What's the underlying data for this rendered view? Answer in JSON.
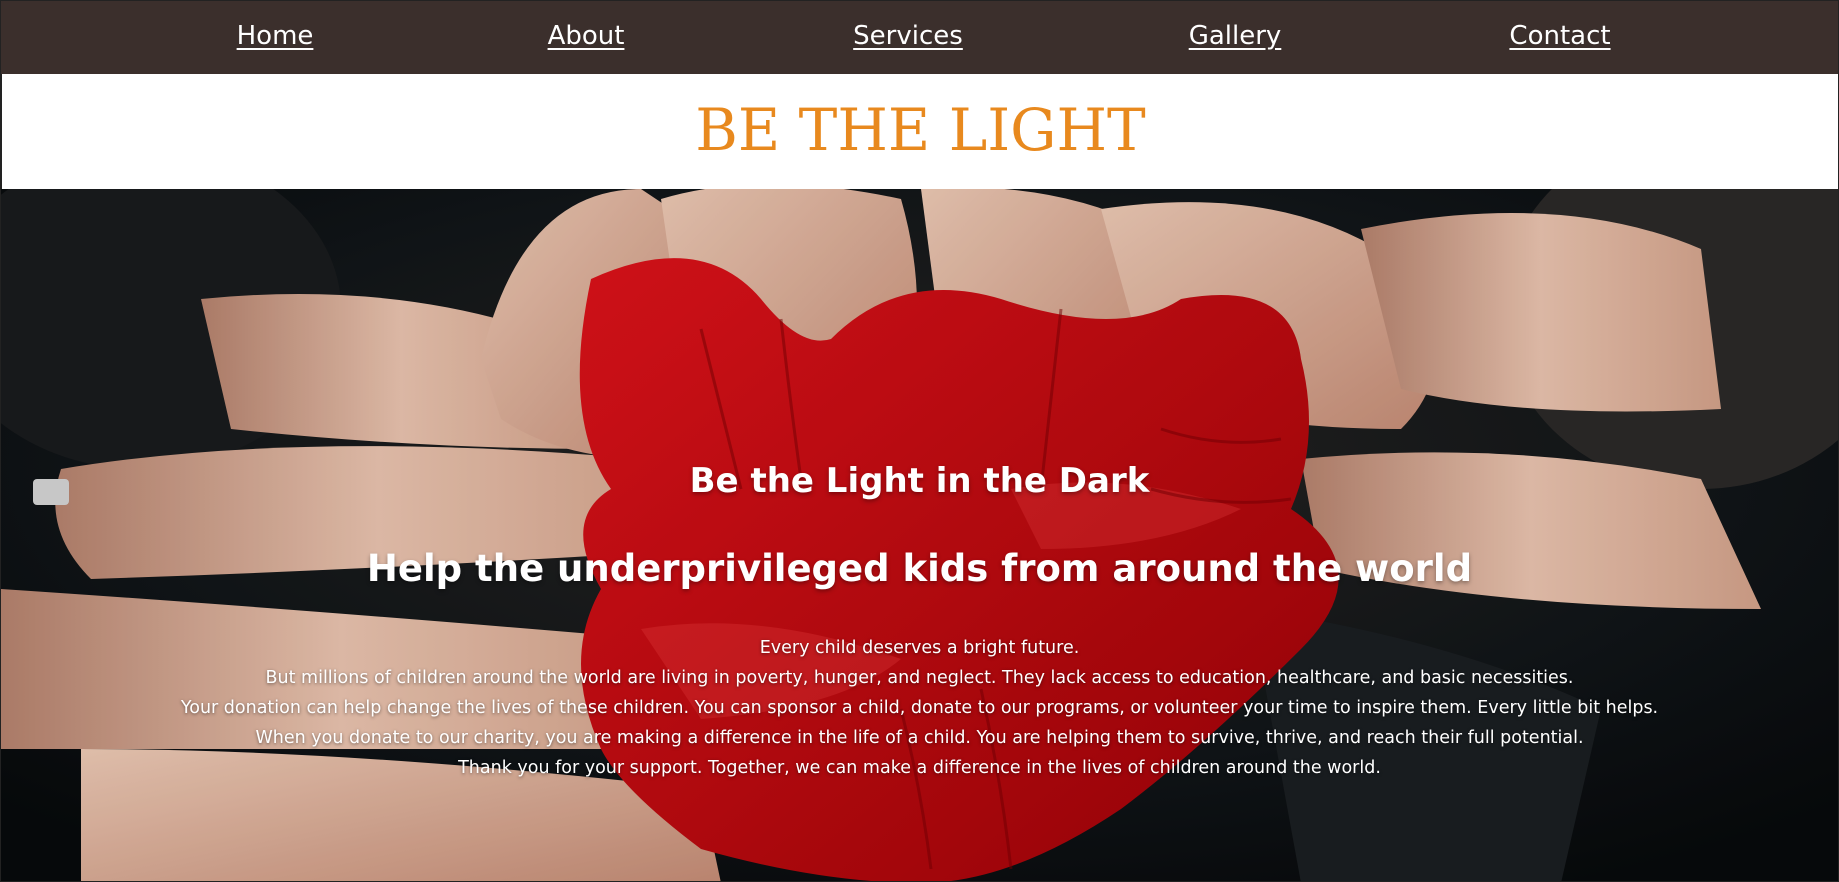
{
  "nav": {
    "items": [
      {
        "label": "Home"
      },
      {
        "label": "About"
      },
      {
        "label": "Services"
      },
      {
        "label": "Gallery"
      },
      {
        "label": "Contact"
      }
    ]
  },
  "brand": {
    "title": "BE THE LIGHT",
    "color": "#e8891e"
  },
  "hero": {
    "heading": "Be the Light in the Dark",
    "subheading": "Help the underprivileged kids from around the world",
    "paragraphs": [
      "Every child deserves a bright future.",
      "But millions of children around the world are living in poverty, hunger, and neglect. They lack access to education, healthcare, and basic necessities.",
      "Your donation can help change the lives of these children. You can sponsor a child, donate to our programs, or volunteer your time to inspire them. Every little bit helps.",
      "When you donate to our charity, you are making a difference in the life of a child. You are helping them to survive, thrive, and reach their full potential.",
      "Thank you for your support. Together, we can make a difference in the lives of children around the world."
    ],
    "image": "hands-painted-red-heart-photo"
  },
  "colors": {
    "nav_bg": "#3b2f2c",
    "brand": "#e8891e",
    "paint": "#c8070c",
    "skin": "#e6b8a0"
  }
}
